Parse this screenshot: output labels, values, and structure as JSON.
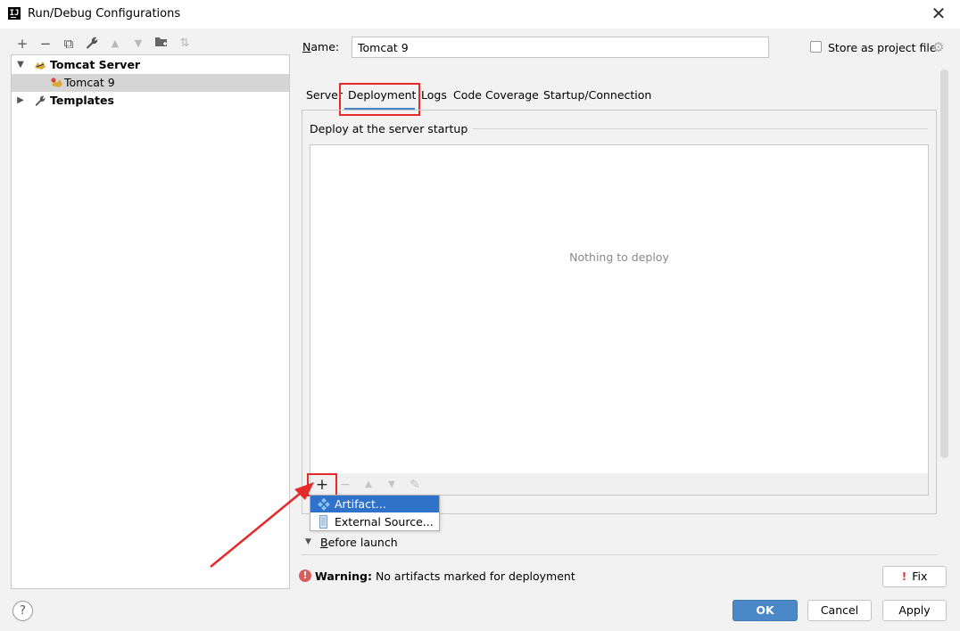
{
  "window": {
    "title": "Run/Debug Configurations",
    "logo": "IJ",
    "close_icon": "close-icon"
  },
  "left_toolbar": {
    "buttons": [
      {
        "name": "add",
        "glyph": "+"
      },
      {
        "name": "remove",
        "glyph": "−"
      },
      {
        "name": "copy",
        "glyph": "⧉"
      },
      {
        "name": "settings",
        "glyph": "🔧"
      },
      {
        "name": "move-up",
        "glyph": "▲"
      },
      {
        "name": "move-down",
        "glyph": "▼"
      },
      {
        "name": "new-folder",
        "glyph": "📁"
      },
      {
        "name": "sort",
        "glyph": "⇅"
      }
    ]
  },
  "tree": {
    "tomcat_server": "Tomcat Server",
    "tomcat_9": "Tomcat 9",
    "templates": "Templates"
  },
  "name_field": {
    "label": "Name:",
    "value": "Tomcat 9"
  },
  "store_as_project_file": {
    "label": "Store as project file",
    "checked": false
  },
  "tabs": [
    "Server",
    "Deployment",
    "Logs",
    "Code Coverage",
    "Startup/Connection"
  ],
  "active_tab": "Deployment",
  "deploy": {
    "section_title": "Deploy at the server startup",
    "empty_text": "Nothing to deploy"
  },
  "popup_menu": {
    "items": [
      {
        "label": "Artifact...",
        "icon": "artifact-icon",
        "selected": true
      },
      {
        "label": "External Source...",
        "icon": "external-source-icon",
        "selected": false
      }
    ]
  },
  "before_launch": {
    "label": "Before launch"
  },
  "warning": {
    "bold": "Warning:",
    "text": " No artifacts marked for deployment"
  },
  "buttons": {
    "fix": "Fix",
    "ok": "OK",
    "cancel": "Cancel",
    "apply": "Apply",
    "help": "?"
  },
  "colors": {
    "accent": "#4a88c7",
    "highlight": "#e52a2a",
    "selection": "#2e73c9",
    "warning": "#db5c5c"
  }
}
